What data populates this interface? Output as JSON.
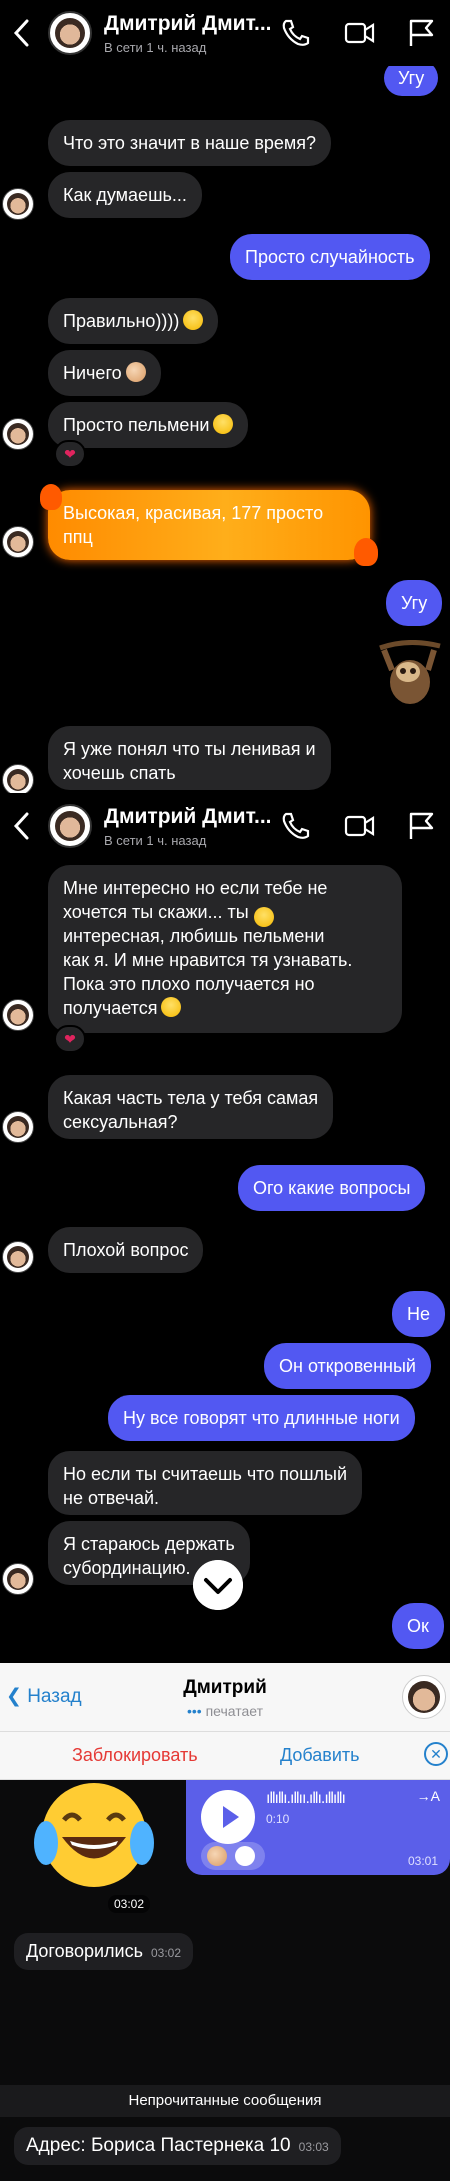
{
  "header": {
    "name": "Дмитрий Дмит...",
    "status": "В сети 1 ч. назад"
  },
  "colors": {
    "outgoing": "#5258f2",
    "incoming": "#262628",
    "reaction_heart": "#e0245e",
    "telegram_link": "#2481cc",
    "telegram_block": "#e53935"
  },
  "screen1": {
    "msgs": [
      {
        "text": "Угу"
      },
      {
        "text": "Что это значит в наше время?"
      },
      {
        "text": "Как думаешь..."
      },
      {
        "text": "Просто случайность"
      },
      {
        "text": "Правильно))))"
      },
      {
        "text": "Ничего"
      },
      {
        "text": "Просто пельмени"
      },
      {
        "text": "Высокая, красивая, 177 просто"
      },
      {
        "text": "ппц"
      },
      {
        "text": "Угу"
      },
      {
        "text": "Я уже понял что ты ленивая и"
      },
      {
        "text": "хочешь спать"
      }
    ],
    "reaction": "❤"
  },
  "screen2": {
    "msgs": [
      {
        "text": "Мне интересно но если тебе не"
      },
      {
        "text": "хочется ты скажи...     ты"
      },
      {
        "text": "интересная, любишь пельмени"
      },
      {
        "text": "как я. И мне нравится тя узнавать."
      },
      {
        "text": "Пока это плохо получается но"
      },
      {
        "text": "получается"
      },
      {
        "text": "Какая часть тела у тебя самая"
      },
      {
        "text": "сексуальная?"
      },
      {
        "text": "Ого какие вопросы"
      },
      {
        "text": "Плохой вопрос"
      },
      {
        "text": "Не"
      },
      {
        "text": "Он откровенный"
      },
      {
        "text": "Ну все говорят что длинные ноги"
      },
      {
        "text": "Но если ты считаешь что пошлый"
      },
      {
        "text": "не отвечай."
      },
      {
        "text": "Я стараюсь держать"
      },
      {
        "text": "субординацию."
      },
      {
        "text": "Ок"
      }
    ],
    "reaction": "❤"
  },
  "telegram": {
    "back_label": "Назад",
    "name": "Дмитрий",
    "status": "печатает",
    "block_label": "Заблокировать",
    "add_label": "Добавить",
    "close_glyph": "✕",
    "voice_wave": "ıllıllı.ıllıı.ıllı.ıllıllı",
    "voice_duration": "0:10",
    "voice_time": "03:01",
    "forward_glyph": "→A",
    "sticker_time": "03:02",
    "msg1": "Договорились",
    "msg1_time": "03:02",
    "unread_label": "Непрочитанные сообщения",
    "msg2": "Адрес: Бориса Пастернека 10",
    "msg2_time": "03:03"
  }
}
